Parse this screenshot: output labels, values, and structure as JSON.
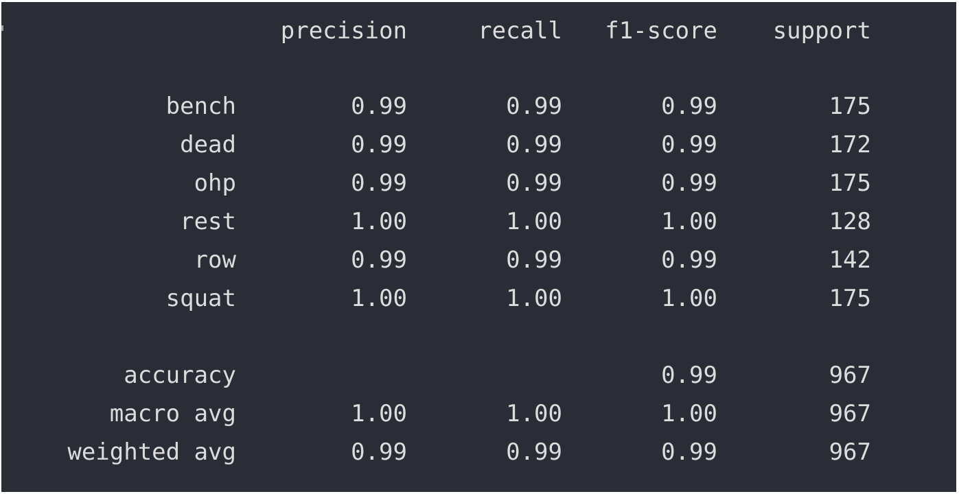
{
  "report": {
    "headers": [
      "precision",
      "recall",
      "f1-score",
      "support"
    ],
    "classes": [
      {
        "label": "bench",
        "precision": "0.99",
        "recall": "0.99",
        "f1": "0.99",
        "support": "175"
      },
      {
        "label": "dead",
        "precision": "0.99",
        "recall": "0.99",
        "f1": "0.99",
        "support": "172"
      },
      {
        "label": "ohp",
        "precision": "0.99",
        "recall": "0.99",
        "f1": "0.99",
        "support": "175"
      },
      {
        "label": "rest",
        "precision": "1.00",
        "recall": "1.00",
        "f1": "1.00",
        "support": "128"
      },
      {
        "label": "row",
        "precision": "0.99",
        "recall": "0.99",
        "f1": "0.99",
        "support": "142"
      },
      {
        "label": "squat",
        "precision": "1.00",
        "recall": "1.00",
        "f1": "1.00",
        "support": "175"
      }
    ],
    "summary": [
      {
        "label": "accuracy",
        "precision": "",
        "recall": "",
        "f1": "0.99",
        "support": "967"
      },
      {
        "label": "macro avg",
        "precision": "1.00",
        "recall": "1.00",
        "f1": "1.00",
        "support": "967"
      },
      {
        "label": "weighted avg",
        "precision": "0.99",
        "recall": "0.99",
        "f1": "0.99",
        "support": "967"
      }
    ]
  }
}
